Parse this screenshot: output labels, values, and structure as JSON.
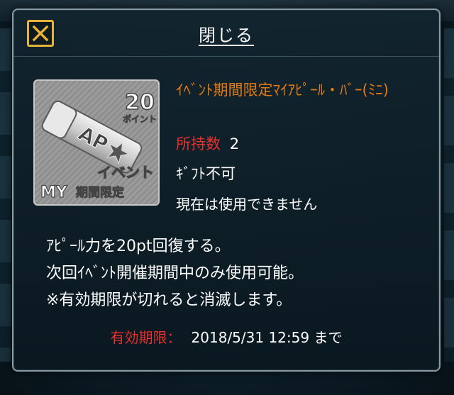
{
  "dialog": {
    "close_label": "閉じる",
    "close_icon": "close-x-icon"
  },
  "item": {
    "name": "ｲﾍﾞﾝﾄ期間限定ﾏｲｱﾋﾟｰﾙ・ﾊﾞｰ(ﾐﾆ)",
    "owned_label": "所持数",
    "owned_count": "2",
    "gift_status": "ｷﾞﾌﾄ不可",
    "usage_status": "現在は使用できません",
    "image": {
      "points_number": "20",
      "points_unit": "ポイント",
      "bar_text": "AP",
      "event_text": "イベント",
      "my_text": "MY",
      "limited_text": "期間限定"
    }
  },
  "description": [
    "ｱﾋﾟｰﾙ力を20pt回復する。",
    "次回ｲﾍﾞﾝﾄ開催期間中のみ使用可能。",
    "※有効期限が切れると消滅します。"
  ],
  "expiry": {
    "label": "有効期限：",
    "value": "2018/5/31 12:59 まで"
  },
  "colors": {
    "accent_gold": "#e6b23a",
    "item_name_orange": "#e07a16",
    "label_red": "#e8302c",
    "panel_bg": "#0c1d27"
  }
}
